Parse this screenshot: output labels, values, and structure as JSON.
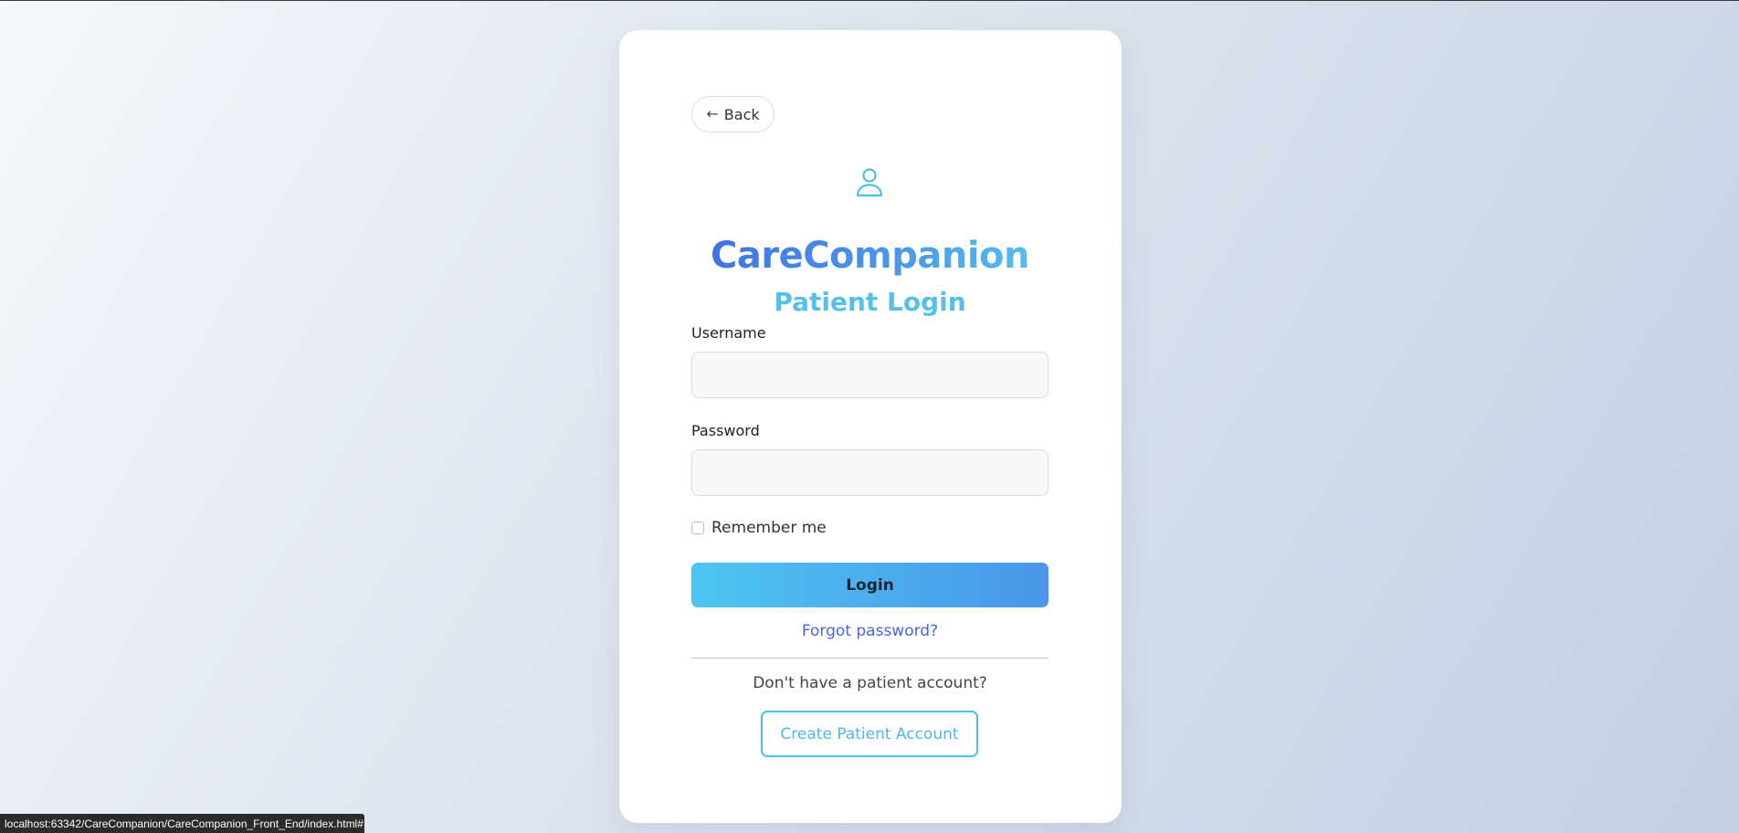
{
  "back": {
    "label": "Back",
    "icon": "arrow-left-icon"
  },
  "header": {
    "icon": "user-icon",
    "brand": "CareCompanion",
    "subtitle": "Patient Login"
  },
  "form": {
    "username_label": "Username",
    "username_value": "",
    "password_label": "Password",
    "password_value": "",
    "remember_label": "Remember me",
    "remember_checked": false,
    "login_label": "Login",
    "forgot_label": "Forgot password?"
  },
  "signup": {
    "prompt": "Don't have a patient account?",
    "create_label": "Create Patient Account"
  },
  "status_bar": {
    "url": "localhost:63342/CareCompanion/CareCompanion_Front_End/index.html#"
  },
  "colors": {
    "brand_start": "#3f6ee6",
    "brand_end": "#56c2ef",
    "accent": "#4cc3ec",
    "link": "#4a63e4"
  }
}
